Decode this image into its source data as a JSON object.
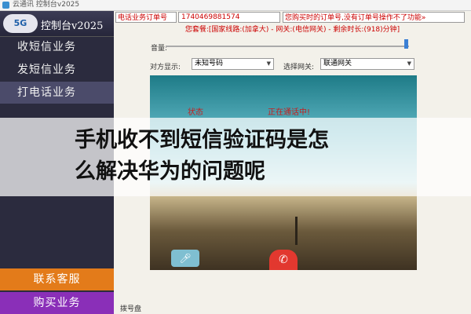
{
  "titlebar": {
    "app_name": "云通讯",
    "title": "控制台v2025"
  },
  "sidebar": {
    "logo_badge": "5G",
    "logo_text": "控制台v2025",
    "items": [
      {
        "label": "收短信业务",
        "active": false
      },
      {
        "label": "发短信业务",
        "active": false
      },
      {
        "label": "打电话业务",
        "active": true
      }
    ],
    "contact_button": "联系客服",
    "buy_button": "购买业务"
  },
  "main": {
    "order_label": "电话业务订单号",
    "order_value": "1740469881574",
    "order_hint": "您购买时的订单号,没有订单号操作不了功能»",
    "package_line": "您套餐:[国家线路:(加拿大) - 网关:(电信网关) - 剩余时长:(918)分钟]",
    "volume_label": "音量:",
    "volume_level": 0.98,
    "display_label": "对方显示:",
    "display_value": "未知号码",
    "gateway_label": "选择网关:",
    "gateway_value": "联通网关",
    "status_label": "状态",
    "status_text": "正在通话中!",
    "dialpad_label": "拨号盘"
  },
  "overlay": {
    "line1": "手机收不到短信验证码是怎",
    "line2": "么解决华为的问题呢"
  },
  "colors": {
    "sidebar_bg": "#2b2b3e",
    "contact": "#e37b1a",
    "buy": "#8a2fb8",
    "hangup": "#e2382f",
    "accent_text": "#c00"
  }
}
